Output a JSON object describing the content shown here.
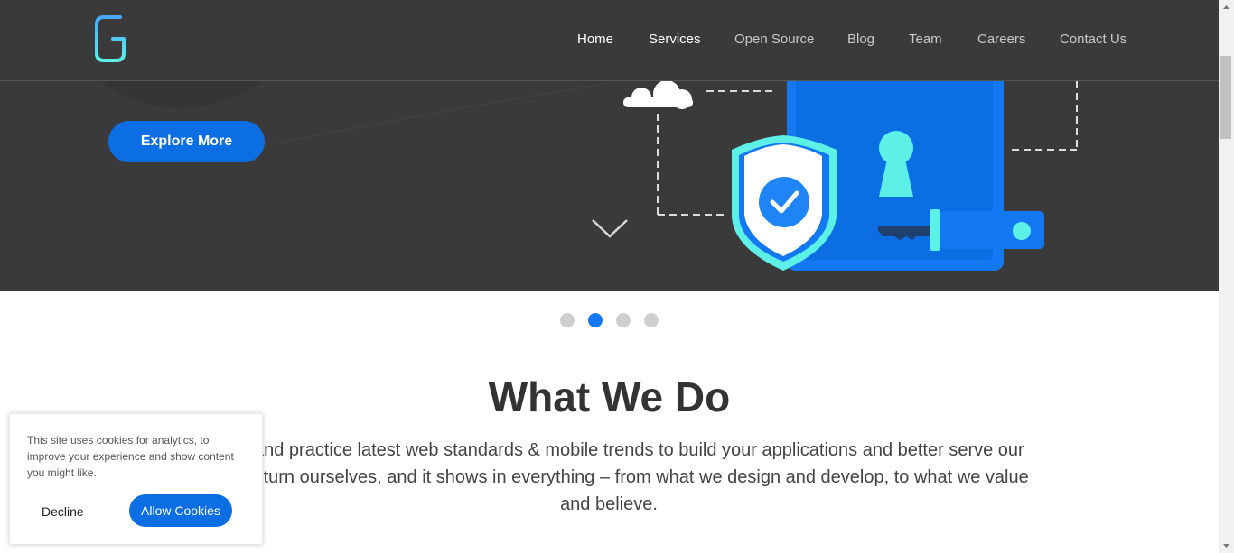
{
  "nav": {
    "items": [
      {
        "label": "Home"
      },
      {
        "label": "Services"
      },
      {
        "label": "Open Source"
      },
      {
        "label": "Blog"
      },
      {
        "label": "Team"
      },
      {
        "label": "Careers"
      },
      {
        "label": "Contact Us"
      }
    ]
  },
  "hero": {
    "cta_label": "Explore More",
    "icons": [
      "cloud-icon",
      "shield-check-icon",
      "keyhole-icon",
      "key-icon",
      "chevron-down-icon"
    ]
  },
  "carousel": {
    "count": 4,
    "active_index": 1
  },
  "section": {
    "title": "What We Do",
    "line1": "nbrace and practice latest web standards & mobile trends to build your applications and better serve our",
    "line2": "rs and in turn ourselves, and it shows in everything – from what we design and develop, to what we value",
    "line3": "and believe."
  },
  "cookie": {
    "message": "This site uses cookies for analytics, to improve your experience and show content you might like.",
    "decline_label": "Decline",
    "allow_label": "Allow Cookies"
  },
  "colors": {
    "header_bg": "#3a3a3a",
    "accent": "#0b6fe3",
    "art_blue": "#1478f2",
    "art_cyan": "#5cf0e6"
  }
}
